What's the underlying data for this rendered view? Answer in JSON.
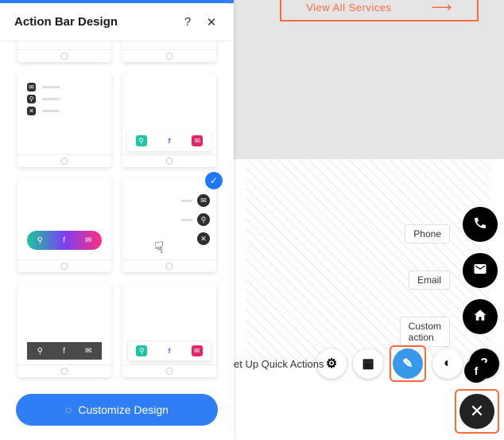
{
  "panel": {
    "title": "Action Bar Design",
    "help_icon": "?",
    "close_icon": "✕",
    "customize_button": "Customize Design",
    "selected_template_index": 3
  },
  "canvas": {
    "services_button": "View All Services",
    "strip_text": "et Up Quick Actions",
    "fab_labels": {
      "phone": "Phone",
      "email": "Email",
      "custom": "Custom action"
    }
  },
  "toolbar_icons": {
    "settings": "⚙",
    "layout": "▦",
    "brush": "✎",
    "contrast": "◐",
    "help": "?"
  },
  "glyphs": {
    "check": "✓",
    "close": "✕",
    "arrow": "⟶",
    "phone": "✆",
    "mail": "✉",
    "home": "⌂",
    "pin": "⚲",
    "f": "f",
    "drop": "◌",
    "cursor": "☟"
  }
}
